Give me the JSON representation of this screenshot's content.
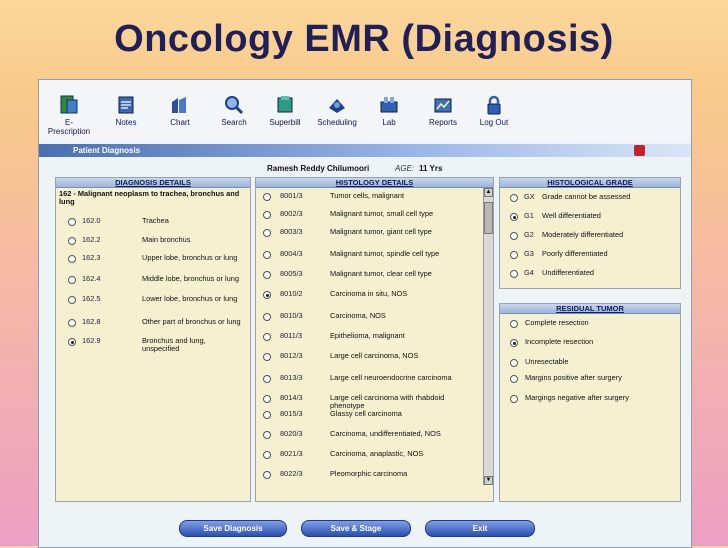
{
  "slide_title": "Oncology EMR (Diagnosis)",
  "toolbar": [
    {
      "label": "E-\nPrescription",
      "icon": "e-prescription-icon"
    },
    {
      "label": "Notes",
      "icon": "notes-icon"
    },
    {
      "label": "Chart",
      "icon": "chart-icon"
    },
    {
      "label": "Search",
      "icon": "search-icon"
    },
    {
      "label": "Superbill",
      "icon": "superbill-icon"
    },
    {
      "label": "Scheduling",
      "icon": "scheduling-icon"
    },
    {
      "label": "Lab",
      "icon": "lab-icon"
    },
    {
      "label": "Reports",
      "icon": "reports-icon"
    },
    {
      "label": "Log Out",
      "icon": "log-out-icon"
    }
  ],
  "section_title": "Patient Diagnosis",
  "patient": {
    "name": "Ramesh Reddy Chilumoori",
    "age_label": "AGE:",
    "age": "11 Yrs"
  },
  "diagnosis": {
    "header": "DIAGNOSIS DETAILS",
    "group": "162 - Malignant neoplasm to trachea, bronchus and lung",
    "items": [
      {
        "code": "162.0",
        "desc": "Trachea",
        "selected": false
      },
      {
        "code": "162.2",
        "desc": "Main bronchus",
        "selected": false
      },
      {
        "code": "162.3",
        "desc": "Upper lobe, bronchus or lung",
        "selected": false
      },
      {
        "code": "162.4",
        "desc": "Middle lobe, bronchus or lung",
        "selected": false
      },
      {
        "code": "162.5",
        "desc": "Lower lobe, bronchus or lung",
        "selected": false
      },
      {
        "code": "162.8",
        "desc": "Other part of bronchus or lung",
        "selected": false
      },
      {
        "code": "162.9",
        "desc": "Bronchus and lung, unspecified",
        "selected": true
      }
    ]
  },
  "histology": {
    "header": "HISTOLOGY DETAILS",
    "items": [
      {
        "code": "8001/3",
        "desc": "Tumor cells, malignant",
        "selected": false
      },
      {
        "code": "8002/3",
        "desc": "Malignant tumor, small cell type",
        "selected": false
      },
      {
        "code": "8003/3",
        "desc": "Malignant tumor, giant cell type",
        "selected": false
      },
      {
        "code": "8004/3",
        "desc": "Malignant tumor, spindle cell type",
        "selected": false
      },
      {
        "code": "8005/3",
        "desc": "Malignant tumor, clear cell type",
        "selected": false
      },
      {
        "code": "8010/2",
        "desc": "Carcinoma in situ, NOS",
        "selected": true
      },
      {
        "code": "8010/3",
        "desc": "Carcinoma, NOS",
        "selected": false
      },
      {
        "code": "8011/3",
        "desc": "Epithelioma, malignant",
        "selected": false
      },
      {
        "code": "8012/3",
        "desc": "Large cell carcinoma, NOS",
        "selected": false
      },
      {
        "code": "8013/3",
        "desc": "Large cell neuroendocrine carcinoma",
        "selected": false
      },
      {
        "code": "8014/3",
        "desc": "Large cell carcinoma with rhabdoid phenotype",
        "selected": false
      },
      {
        "code": "8015/3",
        "desc": "Glassy cell carcinoma",
        "selected": false
      },
      {
        "code": "8020/3",
        "desc": "Carcinoma, undifferentiated, NOS",
        "selected": false
      },
      {
        "code": "8021/3",
        "desc": "Carcinoma, anaplastic, NOS",
        "selected": false
      },
      {
        "code": "8022/3",
        "desc": "Pleomorphic carcinoma",
        "selected": false
      }
    ]
  },
  "grade": {
    "header": "HISTOLOGICAL GRADE",
    "items": [
      {
        "code": "GX",
        "desc": "Grade cannot be assessed",
        "selected": false
      },
      {
        "code": "G1",
        "desc": "Well differentiated",
        "selected": true
      },
      {
        "code": "G2",
        "desc": "Moderately differentiated",
        "selected": false
      },
      {
        "code": "G3",
        "desc": "Poorly differentiated",
        "selected": false
      },
      {
        "code": "G4",
        "desc": "Undifferentiated",
        "selected": false
      }
    ]
  },
  "residual": {
    "header": "RESIDUAL TUMOR",
    "items": [
      {
        "desc": "Complete resection",
        "selected": false
      },
      {
        "desc": "Incomplete resection",
        "selected": true
      },
      {
        "desc": "Unresectable",
        "selected": false
      },
      {
        "desc": "Margins positive after surgery",
        "selected": false
      },
      {
        "desc": "Margings negative after surgery",
        "selected": false
      }
    ]
  },
  "buttons": {
    "save_diagnosis": "Save Diagnosis",
    "save_stage": "Save & Stage",
    "exit": "Exit"
  },
  "colors": {
    "panel_bg": "#f4f0d0",
    "header_blue": "#9db5db",
    "button_blue": "#2a4fb0",
    "title_navy": "#1f1f5a"
  }
}
